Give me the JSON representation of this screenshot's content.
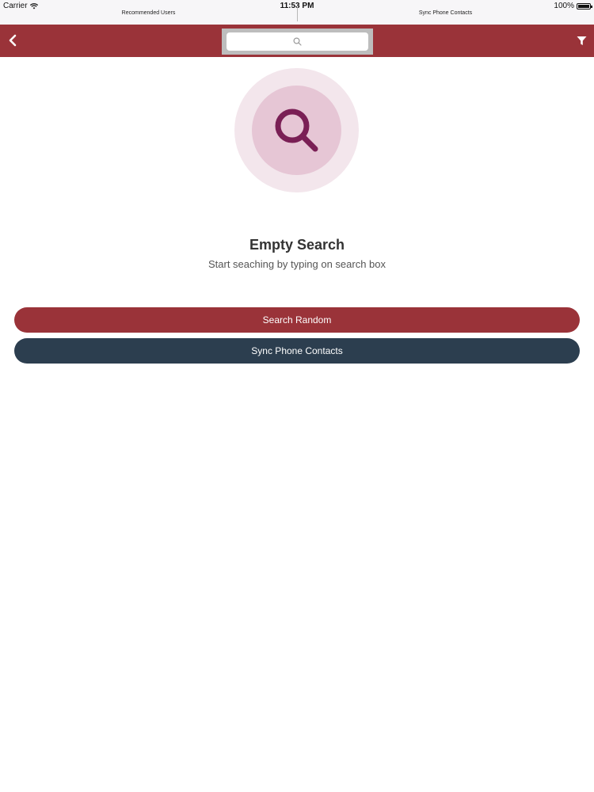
{
  "status_bar": {
    "carrier": "Carrier",
    "time": "11:53 PM",
    "battery": "100%",
    "battery_level": 1.0
  },
  "segments": [
    {
      "label": "Recommended Users"
    },
    {
      "label": "Sync Phone Contacts"
    }
  ],
  "nav": {
    "back_icon": "chevron-left-icon",
    "filter_icon": "filter-icon",
    "search_icon": "search-icon",
    "search_placeholder": ""
  },
  "empty_state": {
    "icon": "search-icon",
    "title": "Empty Search",
    "subtitle": "Start seaching by typing on search box"
  },
  "buttons": {
    "search_random": "Search Random",
    "sync_contacts": "Sync Phone Contacts"
  },
  "colors": {
    "brand_red": "#9a3339",
    "navy": "#2c3e4f",
    "icon_purple": "#7a1f55",
    "circle_outer": "#f3e6ec",
    "circle_inner": "#e6c6d5"
  }
}
